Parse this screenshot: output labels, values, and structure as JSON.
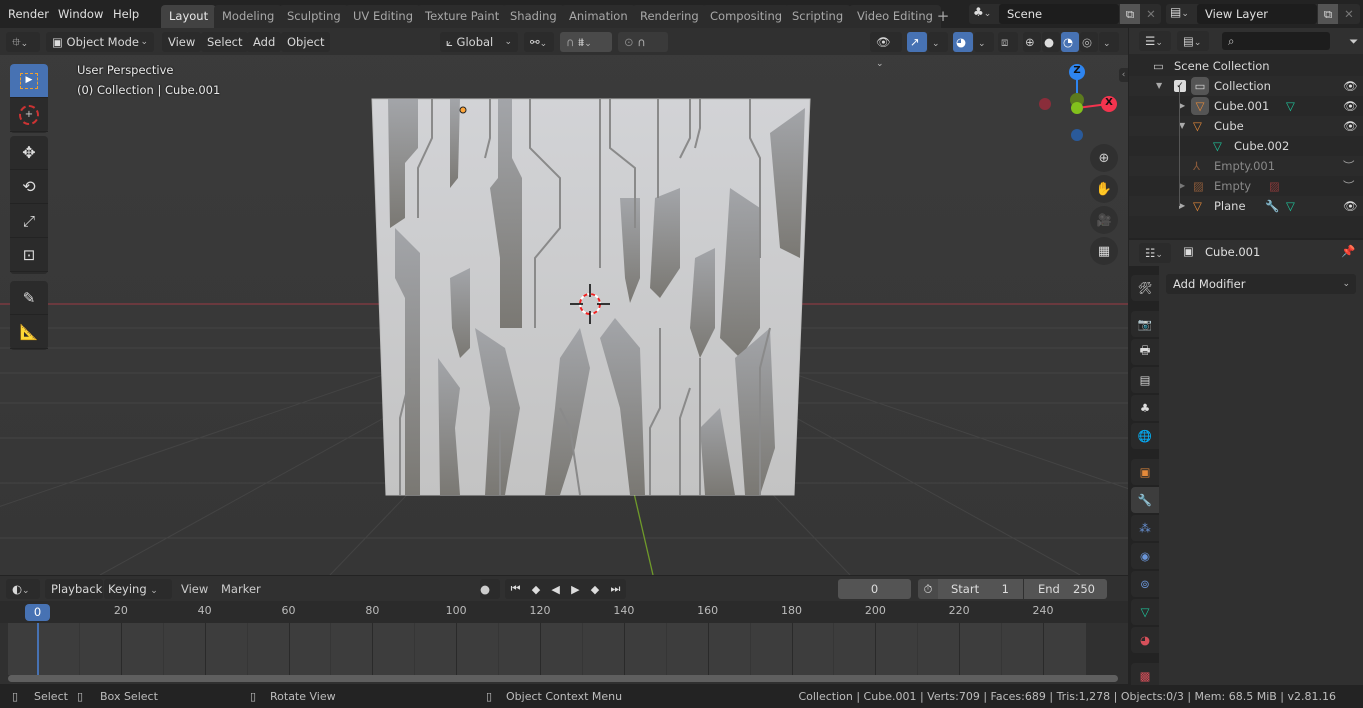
{
  "topbar": {
    "menus": [
      "Render",
      "Window",
      "Help"
    ],
    "workspace_tabs": [
      {
        "label": "Layout",
        "active": true
      },
      {
        "label": "Modeling",
        "active": false
      },
      {
        "label": "Sculpting",
        "active": false
      },
      {
        "label": "UV Editing",
        "active": false
      },
      {
        "label": "Texture Paint",
        "active": false
      },
      {
        "label": "Shading",
        "active": false
      },
      {
        "label": "Animation",
        "active": false
      },
      {
        "label": "Rendering",
        "active": false
      },
      {
        "label": "Compositing",
        "active": false
      },
      {
        "label": "Scripting",
        "active": false
      },
      {
        "label": "Video Editing",
        "active": false
      }
    ],
    "add_workspace": "+",
    "scene_name": "Scene",
    "view_layer_name": "View Layer"
  },
  "viewport_header": {
    "mode": "Object Mode",
    "menus": [
      "View",
      "Select",
      "Add",
      "Object"
    ],
    "orientation": "Global"
  },
  "viewport": {
    "perspective_label": "User Perspective",
    "collection_label": "(0) Collection | Cube.001",
    "gizmo": {
      "x": "X",
      "y": "Y",
      "z": "Z"
    },
    "colors": {
      "x_axis": "#f3344e",
      "y_axis": "#82c11c",
      "z_axis": "#2e85f0",
      "active_tool": "#4772b3"
    }
  },
  "tools": [
    "select-box",
    "cursor",
    "move",
    "rotate",
    "scale",
    "transform",
    "annotate",
    "measure"
  ],
  "outliner": {
    "root": "Scene Collection",
    "items": [
      {
        "label": "Collection",
        "type": "collection",
        "visible": true
      },
      {
        "label": "Cube.001",
        "type": "mesh",
        "visible": true,
        "selected": true
      },
      {
        "label": "Cube",
        "type": "mesh",
        "visible": true
      },
      {
        "label": "Cube.002",
        "type": "mesh-data",
        "visible": null
      },
      {
        "label": "Empty.001",
        "type": "empty",
        "visible": false
      },
      {
        "label": "Empty",
        "type": "image-empty",
        "visible": false
      },
      {
        "label": "Plane",
        "type": "mesh",
        "visible": true
      }
    ]
  },
  "properties": {
    "object_name": "Cube.001",
    "add_modifier": "Add Modifier"
  },
  "timeline": {
    "menus": [
      "Playback",
      "Keying",
      "View",
      "Marker"
    ],
    "current_frame": "0",
    "start_label": "Start",
    "start_value": "1",
    "end_label": "End",
    "end_value": "250",
    "ruler": [
      "20",
      "40",
      "60",
      "80",
      "100",
      "120",
      "140",
      "160",
      "180",
      "200",
      "220",
      "240"
    ],
    "playhead": "0"
  },
  "statusbar": {
    "select": "Select",
    "box_select": "Box Select",
    "rotate_view": "Rotate View",
    "context_menu": "Object Context Menu",
    "stats": "Collection | Cube.001 | Verts:709 | Faces:689 | Tris:1,278 | Objects:0/3 | Mem: 68.5 MiB | v2.81.16"
  }
}
